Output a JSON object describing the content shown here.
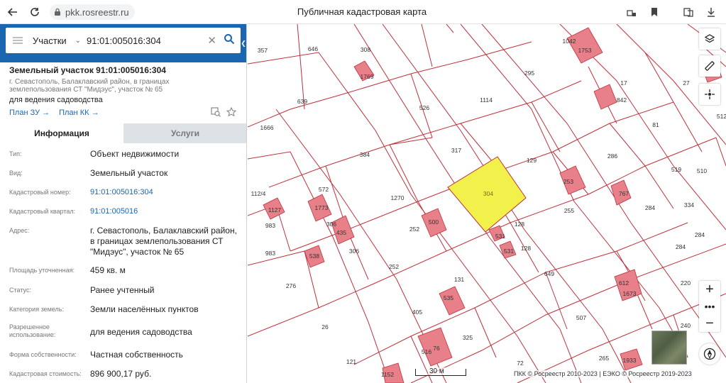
{
  "browser": {
    "url": "pkk.rosreestr.ru",
    "page_title": "Публичная кадастровая карта"
  },
  "search": {
    "type_label": "Участки",
    "query": "91:01:005016:304"
  },
  "object": {
    "title": "Земельный участок 91:01:005016:304",
    "address_line": "г. Севастополь, Балаклавский район, в границах землепользования СТ \"Мидэус\", участок № 65",
    "purpose": "для ведения садоводства",
    "plan_zu": "План ЗУ →",
    "plan_kk": "План КК →"
  },
  "tabs": {
    "info": "Информация",
    "services": "Услуги"
  },
  "properties": [
    {
      "label": "Тип:",
      "value": "Объект недвижимости"
    },
    {
      "label": "Вид:",
      "value": "Земельный участок"
    },
    {
      "label": "Кадастровый номер:",
      "value": "91:01:005016:304"
    },
    {
      "label": "Кадастровый квартал:",
      "value": "91:01:005016"
    },
    {
      "label": "Адрес:",
      "value": "г. Севастополь, Балаклавский район, в границах землепользования СТ \"Мидэус\", участок № 65"
    },
    {
      "label": "Площадь уточненная:",
      "value": "459 кв. м"
    },
    {
      "label": "Статус:",
      "value": "Ранее учтенный"
    },
    {
      "label": "Категория земель:",
      "value": "Земли населённых пунктов"
    },
    {
      "label": "Разрешенное использование:",
      "value": "для ведения садоводства"
    },
    {
      "label": "Форма собственности:",
      "value": "Частная собственность"
    },
    {
      "label": "Кадастровая стоимость:",
      "value": "896 900,17 руб."
    }
  ],
  "map": {
    "scale_label": "30 м",
    "copyright": "ПКК © Росреестр 2010-2023 | ЕЭКО © Росреестр 2019-2023",
    "selected_parcel": "304",
    "parcel_labels": [
      "357",
      "646",
      "308",
      "1769",
      "1042",
      "1753",
      "295",
      "639",
      "1114",
      "526",
      "17",
      "842",
      "81",
      "1666",
      "317",
      "129",
      "384",
      "286",
      "519",
      "112/4",
      "572",
      "1773",
      "1270",
      "304",
      "253",
      "767",
      "284",
      "1127",
      "983",
      "306",
      "435",
      "252",
      "500",
      "128",
      "531",
      "531",
      "255",
      "983",
      "538",
      "306",
      "252",
      "128",
      "649",
      "276",
      "131",
      "535",
      "612",
      "1673",
      "405",
      "507",
      "240",
      "26",
      "325",
      "76",
      "516",
      "121",
      "72",
      "265",
      "1933",
      "1152",
      "27",
      "512",
      "510",
      "334",
      "284",
      "284",
      "220"
    ]
  }
}
